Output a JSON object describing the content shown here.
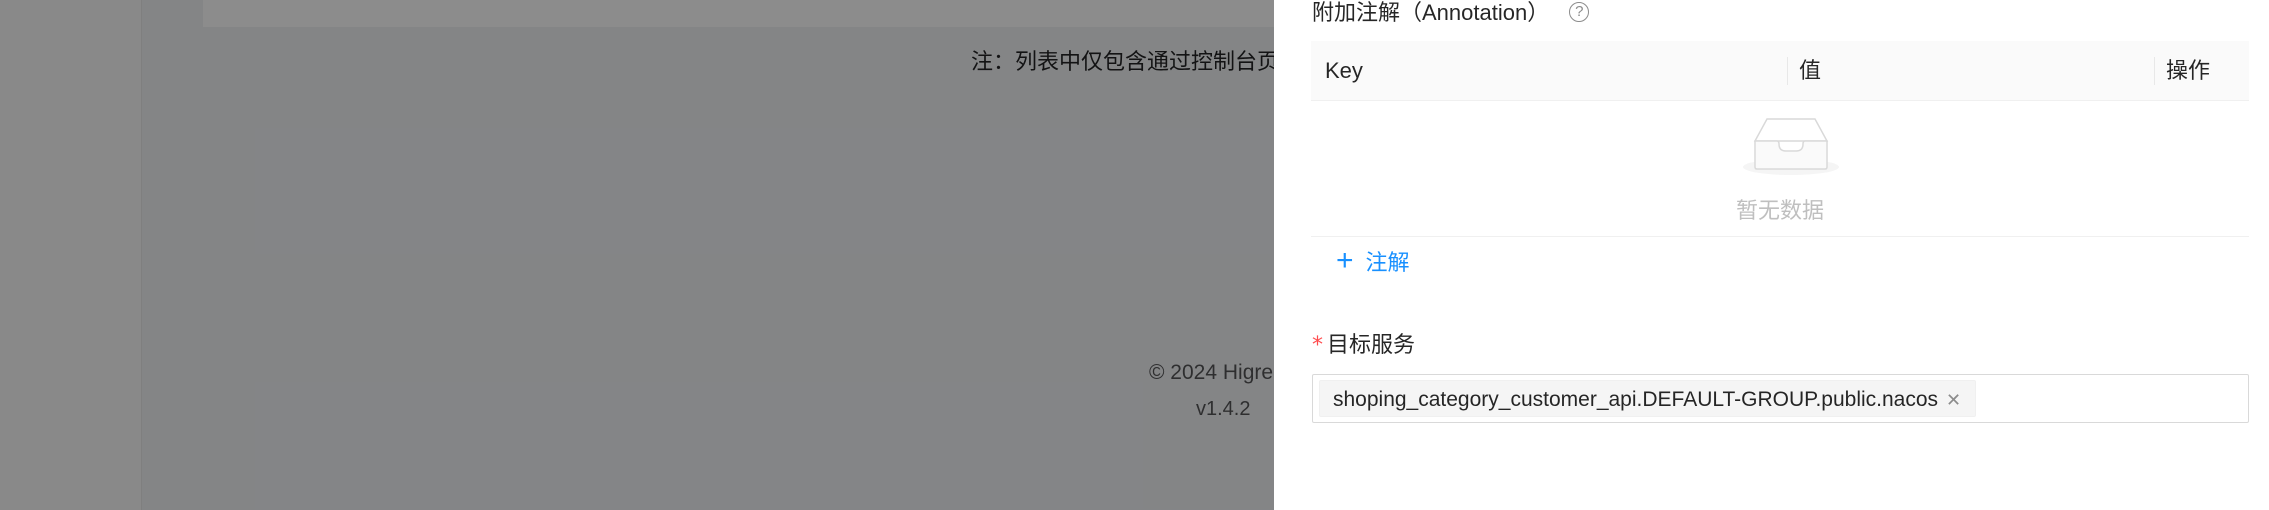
{
  "background": {
    "note": "注：列表中仅包含通过控制台页",
    "copyright": "© 2024 Higre",
    "version": "v1.4.2"
  },
  "drawer": {
    "annotation_section": {
      "label": "附加注解（Annotation）",
      "help_icon": "question-circle-icon",
      "table": {
        "columns": [
          "Key",
          "值",
          "操作"
        ],
        "rows": [],
        "empty_text": "暂无数据",
        "empty_icon": "inbox-empty-icon"
      },
      "add_button_label": "注解",
      "add_button_icon": "plus-icon"
    },
    "target_service": {
      "required_mark": "*",
      "label": "目标服务",
      "selected_tags": [
        {
          "label": "shoping_category_customer_api.DEFAULT-GROUP.public.nacos",
          "close_icon": "close-icon"
        }
      ]
    }
  },
  "colors": {
    "primary": "#1890ff",
    "required": "#ff4d4f",
    "mask": "rgba(0,0,0,0.45)"
  }
}
